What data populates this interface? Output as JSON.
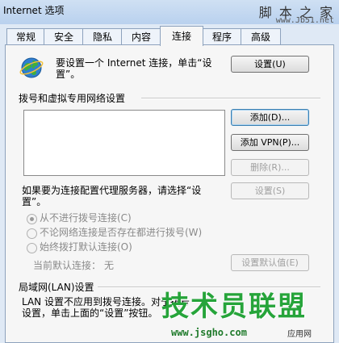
{
  "window": {
    "title": "Internet 选项",
    "watermark_top": "脚 本 之 家",
    "watermark_url": "www.Jb51.net"
  },
  "tabs": [
    {
      "label": "常规"
    },
    {
      "label": "安全"
    },
    {
      "label": "隐私"
    },
    {
      "label": "内容"
    },
    {
      "label": "连接"
    },
    {
      "label": "程序"
    },
    {
      "label": "高级"
    }
  ],
  "setup": {
    "line1": "要设置一个 Internet 连接，单击“设",
    "line2": "置”。",
    "button": "设置(U)"
  },
  "dialup": {
    "section_title": "拨号和虚拟专用网络设置",
    "add_button": "添加(D)...",
    "add_vpn_button": "添加 VPN(P)...",
    "remove_button": "删除(R)...",
    "proxy_text_line1": "如果要为连接配置代理服务器，请选择“设",
    "proxy_text_line2": "置”。",
    "settings_button": "设置(S)",
    "options": [
      {
        "label": "从不进行拨号连接(C)",
        "selected": true
      },
      {
        "label": "不论网络连接是否存在都进行拨号(W)",
        "selected": false
      },
      {
        "label": "始终拨打默认连接(O)",
        "selected": false
      }
    ],
    "current_default_label": "当前默认连接：",
    "current_default_value": "无",
    "set_default_button": "设置默认值(E)"
  },
  "lan": {
    "section_title": "局域网(LAN)设置",
    "line1": "LAN 设置不应用到拨号连接。对于拨号",
    "line2": "设置，单击上面的“设置”按钮。",
    "watermark_big": "技术员联盟",
    "watermark_small": "www.jsgho.com",
    "watermark_small2": "应用网"
  },
  "colors": {
    "accent": "#3c7fb1",
    "watermark_green": "#26a43a"
  }
}
